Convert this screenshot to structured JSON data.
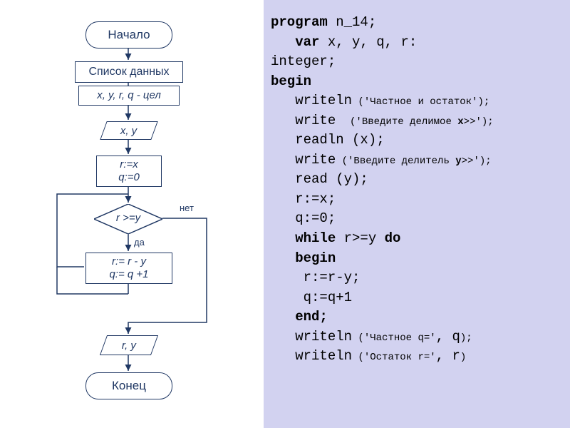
{
  "flowchart": {
    "start": "Начало",
    "data_list": "Список данных",
    "vars": "x, y, r, q - цел",
    "input1": "x, y",
    "init_r": "r:=x",
    "init_q": "q:=0",
    "cond": "r >=y",
    "yes": "да",
    "no": "нет",
    "body_r": "r:= r - y",
    "body_q": "q:= q +1",
    "output": "r, y",
    "end": "Конец"
  },
  "code": {
    "l1a": "program",
    "l1b": " n_14;",
    "l2a": "   var",
    "l2b": " x, y, q, r:",
    "l3": "integer;",
    "l4": "begin",
    "l5a": "   writeln",
    "l5b": " ('Частное и остаток');",
    "l6a": "   write ",
    "l6b": " ('Введите делимое ",
    "l6c": "x",
    "l6d": ">>');",
    "l7a": "   readln (x);",
    "l8a": "   write",
    "l8b": " ('Введите делитель ",
    "l8c": "y",
    "l8d": ">>');",
    "l9": "   read (y);",
    "l10": "   r:=x;",
    "l11": "   q:=0;",
    "l12a": "   while",
    "l12b": " r>=y ",
    "l12c": "do",
    "l13": "   begin",
    "l14": "    r:=r-y;",
    "l15": "    q:=q+1",
    "l16": "   end;",
    "l17a": "   writeln",
    "l17b": " ('Частное q='",
    "l17c": ", q",
    "l17d": ");",
    "l18a": "   writeln",
    "l18b": " ('Остаток r='",
    "l18c": ", r",
    "l18d": ")"
  },
  "chart_data": {
    "type": "flowchart",
    "nodes": [
      {
        "id": "start",
        "kind": "terminator",
        "label": "Начало"
      },
      {
        "id": "datalist",
        "kind": "process",
        "label": "Список данных"
      },
      {
        "id": "vars",
        "kind": "process",
        "label": "x, y, r, q - цел"
      },
      {
        "id": "in",
        "kind": "io",
        "label": "x, y"
      },
      {
        "id": "init",
        "kind": "process",
        "label": "r:=x; q:=0"
      },
      {
        "id": "cond",
        "kind": "decision",
        "label": "r >= y"
      },
      {
        "id": "body",
        "kind": "process",
        "label": "r:=r-y; q:=q+1"
      },
      {
        "id": "out",
        "kind": "io",
        "label": "r, y"
      },
      {
        "id": "end",
        "kind": "terminator",
        "label": "Конец"
      }
    ],
    "edges": [
      {
        "from": "start",
        "to": "datalist"
      },
      {
        "from": "datalist",
        "to": "vars"
      },
      {
        "from": "vars",
        "to": "in"
      },
      {
        "from": "in",
        "to": "init"
      },
      {
        "from": "init",
        "to": "cond"
      },
      {
        "from": "cond",
        "to": "body",
        "label": "да"
      },
      {
        "from": "cond",
        "to": "out",
        "label": "нет"
      },
      {
        "from": "body",
        "to": "cond",
        "loop": true
      },
      {
        "from": "out",
        "to": "end"
      }
    ]
  }
}
